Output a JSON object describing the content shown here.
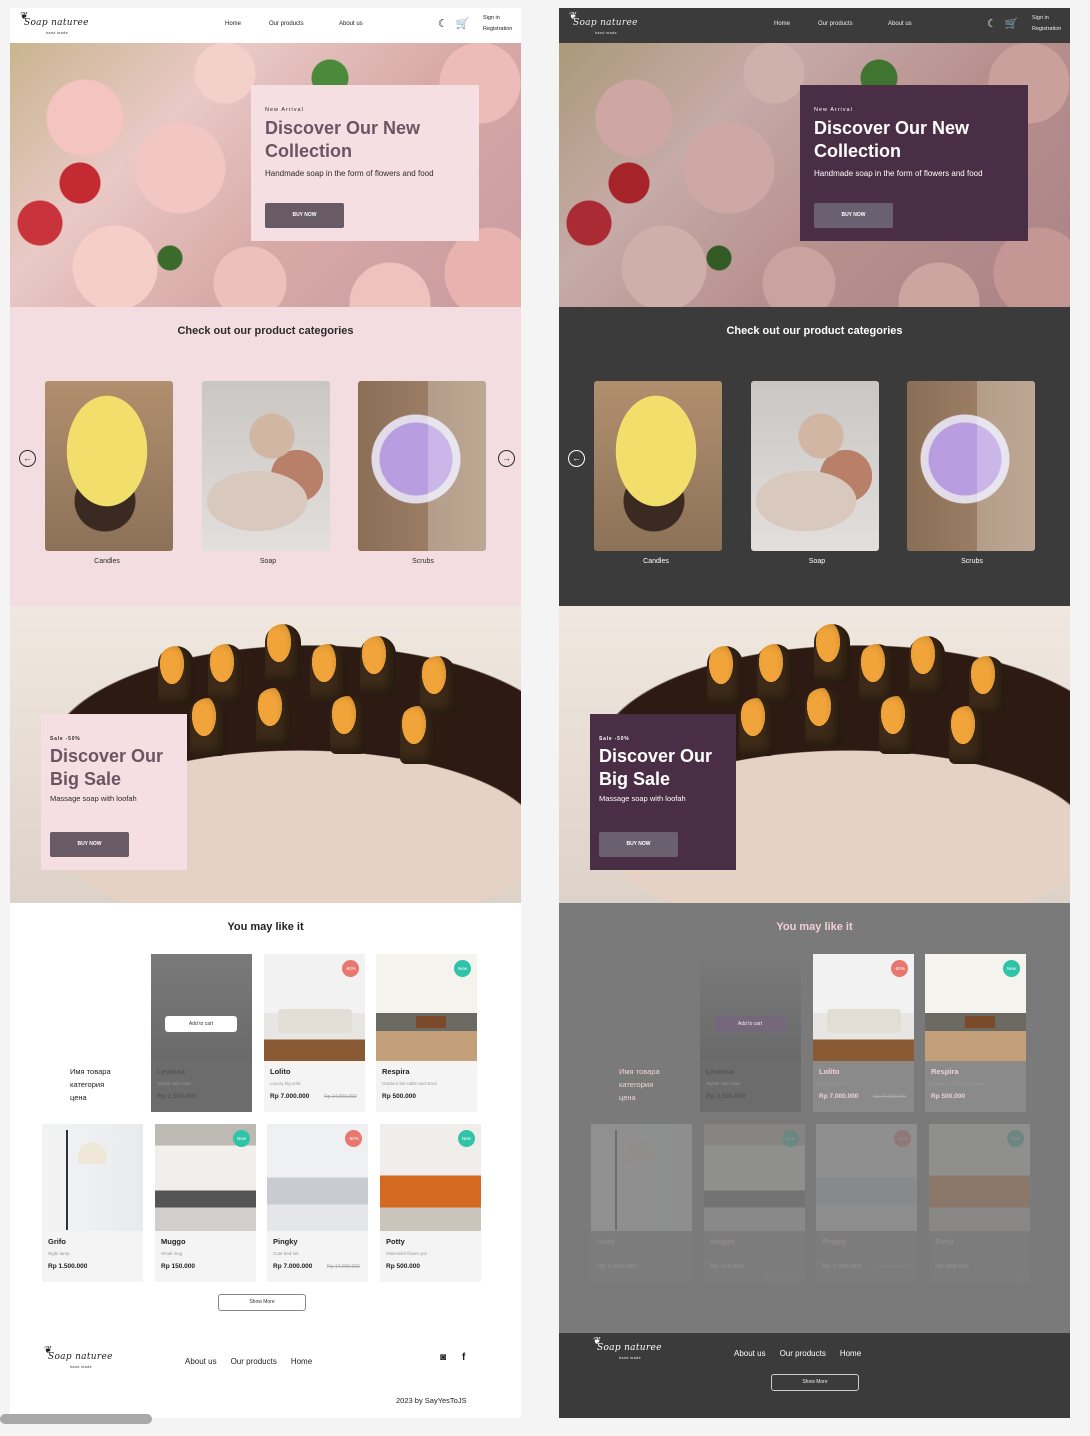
{
  "brand": {
    "name": "Soap naturee",
    "tagline": "hand made"
  },
  "nav": {
    "home": "Home",
    "products": "Our products",
    "about": "About us"
  },
  "header_icons": {
    "theme": "moon-icon",
    "cart": "cart-icon"
  },
  "auth": {
    "sign_in": "Sign in",
    "registration": "Registration"
  },
  "hero": {
    "eyebrow": "New Arrival",
    "title": "Discover Our New Collection",
    "subtitle": "Handmade soap in the form of flowers and food",
    "cta": "BUY NOW"
  },
  "categories": {
    "title": "Check out our product categories",
    "items": [
      {
        "label": "Candles"
      },
      {
        "label": "Soap"
      },
      {
        "label": "Scrubs"
      }
    ],
    "prev_icon": "arrow-left-icon",
    "next_icon": "arrow-right-icon"
  },
  "sale": {
    "eyebrow": "Sale -50%",
    "title": "Discover Our Big Sale",
    "subtitle": "Massage soap with loofah",
    "cta": "BUY NOW"
  },
  "products": {
    "title": "You may like it",
    "placeholder_lines": [
      "Имя товара",
      "категория",
      "цена"
    ],
    "add_to_cart": "Add to cart",
    "show_more": "Show More",
    "row1": [
      {
        "name": "Leviosa",
        "desc": "Stylish cafe chair",
        "price": "Rp 2.500.000",
        "old": "",
        "badge": ""
      },
      {
        "name": "Lolito",
        "desc": "Luxury big sofa",
        "price": "Rp 7.000.000",
        "old": "Rp 14.000.000",
        "badge": "-50%"
      },
      {
        "name": "Respira",
        "desc": "Outdoor bar table and stool",
        "price": "Rp 500.000",
        "old": "",
        "badge": "New"
      }
    ],
    "row2": [
      {
        "name": "Grifo",
        "desc": "Night lamp",
        "price": "Rp 1.500.000",
        "old": "",
        "badge": ""
      },
      {
        "name": "Muggo",
        "desc": "Small mug",
        "price": "Rp 150.000",
        "old": "",
        "badge": "New"
      },
      {
        "name": "Pingky",
        "desc": "Cute bed set",
        "price": "Rp 7.000.000",
        "old": "Rp 14.000.000",
        "badge": "-50%"
      },
      {
        "name": "Potty",
        "desc": "Minimalist flower pot",
        "price": "Rp 500.000",
        "old": "",
        "badge": "New"
      }
    ]
  },
  "footer": {
    "links": [
      "About us",
      "Our products",
      "Home"
    ],
    "social": [
      "instagram-icon",
      "facebook-icon"
    ],
    "instagram_glyph": "◙",
    "facebook_glyph": "f",
    "copyright": "2023 by SayYesToJS"
  },
  "colors": {
    "pink": "#f4dde1",
    "plum": "#4a2e45",
    "dark": "#3b3b3b",
    "sale_badge": "#e8776f",
    "new_badge": "#2fc3a8"
  }
}
